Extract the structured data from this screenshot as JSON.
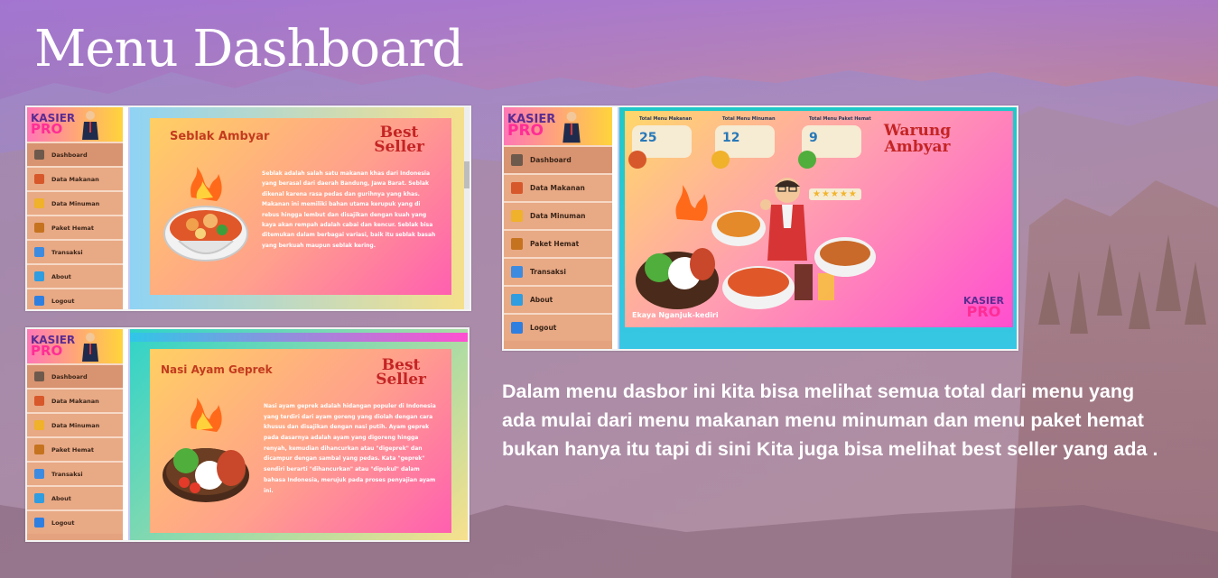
{
  "page": {
    "title": "Menu Dashboard",
    "description": "Dalam menu dasbor ini kita bisa melihat semua total dari menu yang ada mulai dari menu makanan menu minuman dan menu paket hemat bukan hanya itu tapi di sini Kita juga bisa melihat best seller yang ada ."
  },
  "app": {
    "logo_line1": "KASIER",
    "logo_line2": "PRO"
  },
  "sidebar": {
    "items": [
      {
        "label": "Dashboard",
        "icon": "dashboard-icon"
      },
      {
        "label": "Data Makanan",
        "icon": "food-icon"
      },
      {
        "label": "Data Minuman",
        "icon": "drink-icon"
      },
      {
        "label": "Paket Hemat",
        "icon": "package-icon"
      },
      {
        "label": "Transaksi",
        "icon": "transaction-icon"
      },
      {
        "label": "About",
        "icon": "about-icon"
      },
      {
        "label": "Logout",
        "icon": "logout-icon"
      }
    ]
  },
  "screen1": {
    "title": "Seblak Ambyar",
    "badge_line1": "Best",
    "badge_line2": "Seller",
    "body": "Seblak adalah salah satu makanan khas dari Indonesia yang berasal dari daerah Bandung, Jawa Barat. Seblak dikenal karena rasa pedas dan gurihnya yang khas. Makanan ini memiliki bahan utama kerupuk yang di rebus hingga lembut dan disajikan dengan kuah yang kaya akan rempah adalah cabai dan kencur. Seblak bisa ditemukan dalam berbagai variasi, baik itu seblak basah yang berkuah maupun seblak kering."
  },
  "screen2": {
    "title": "Nasi Ayam Geprek",
    "badge_line1": "Best",
    "badge_line2": "Seller",
    "body": "Nasi ayam geprek adalah hidangan populer di Indonesia yang terdiri dari ayam goreng yang diolah dengan cara khusus dan disajikan dengan nasi putih. Ayam geprek pada dasarnya adalah ayam yang digoreng hingga renyah, kemudian dihancurkan atau \"digeprek\" dan dicampur dengan sambal yang pedas. Kata \"geprek\" sendiri berarti \"dihancurkan\" atau \"dipukul\" dalam bahasa Indonesia, merujuk pada proses penyajian ayam ini."
  },
  "dashboard": {
    "stats": [
      {
        "label": "Total Menu Makanan",
        "value": "25"
      },
      {
        "label": "Total Menu Minuman",
        "value": "12"
      },
      {
        "label": "Total Menu Paket Hemat",
        "value": "9"
      }
    ],
    "brand_line1": "Warung",
    "brand_line2": "Ambyar",
    "footer": "Ekaya Nganjuk-kediri",
    "logo_line1": "KASIER",
    "logo_line2": "PRO",
    "rating_stars": 5
  },
  "colors": {
    "sidebar": "#e4a27e",
    "card_gradient_start": "#ffcf63",
    "card_gradient_end": "#ff5fb0",
    "title_red": "#c42424"
  }
}
